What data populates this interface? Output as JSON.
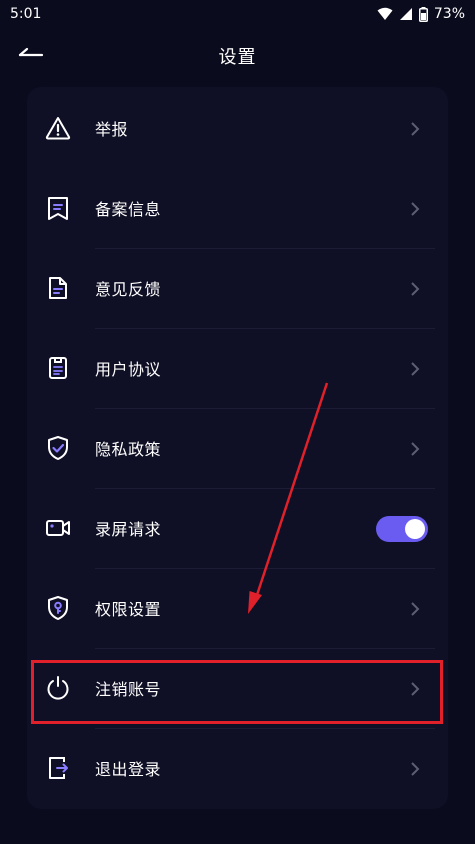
{
  "status_bar": {
    "time": "5:01",
    "battery": "73%",
    "icons": [
      "wifi-icon",
      "signal-icon",
      "battery-icon"
    ]
  },
  "header": {
    "title": "设置",
    "back_icon": "back-arrow-icon"
  },
  "settings": {
    "items": [
      {
        "label": "举报",
        "icon": "warning-icon"
      },
      {
        "label": "备案信息",
        "icon": "bookmark-doc-icon"
      },
      {
        "label": "意见反馈",
        "icon": "document-icon"
      },
      {
        "label": "用户协议",
        "icon": "agreement-icon"
      },
      {
        "label": "隐私政策",
        "icon": "shield-check-icon"
      },
      {
        "label": "录屏请求",
        "icon": "video-camera-icon",
        "toggle": true
      },
      {
        "label": "权限设置",
        "icon": "shield-key-icon"
      },
      {
        "label": "注销账号",
        "icon": "power-icon"
      },
      {
        "label": "退出登录",
        "icon": "logout-icon"
      }
    ]
  },
  "colors": {
    "background": "#0b0b1e",
    "card": "#0f0f25",
    "accent": "#6a5cf0",
    "icon": "#ffffff",
    "chevron": "#5d5d73",
    "annotation": "#e0202a"
  }
}
